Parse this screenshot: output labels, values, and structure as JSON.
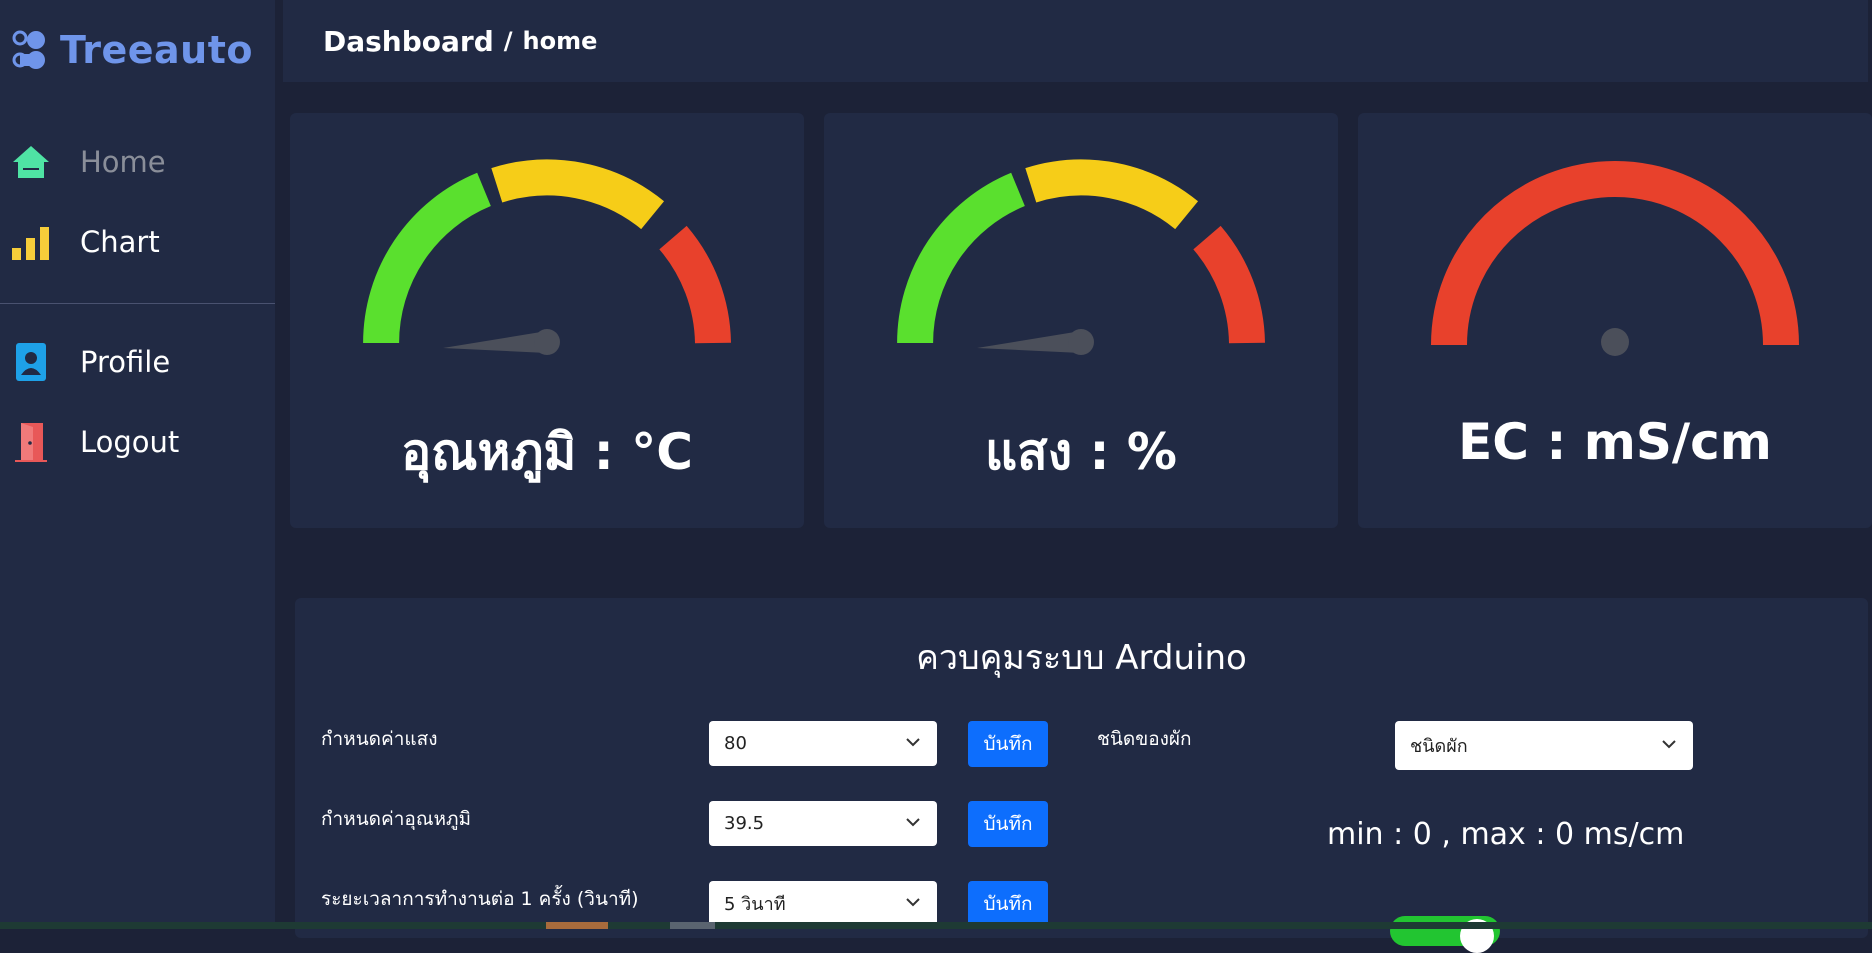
{
  "brand": {
    "name": "Treeauto"
  },
  "sidebar": {
    "items": [
      {
        "label": "Home",
        "icon": "home-icon",
        "active": true
      },
      {
        "label": "Chart",
        "icon": "bar-chart-icon",
        "active": false
      },
      {
        "label": "Profile",
        "icon": "profile-badge-icon",
        "active": false
      },
      {
        "label": "Logout",
        "icon": "door-icon",
        "active": false
      }
    ]
  },
  "header": {
    "title": "Dashboard",
    "separator": "/",
    "sub": "home"
  },
  "gauges": [
    {
      "title": "อุณหภูมิ : °C",
      "needle": "low"
    },
    {
      "title": "แสง : %",
      "needle": "low"
    },
    {
      "title": "EC : mS/cm",
      "needle": "none"
    }
  ],
  "panel": {
    "title": "ควบคุมระบบ Arduino",
    "light_label": "กำหนดค่าแสง",
    "light_value": "80",
    "temp_label": "กำหนดค่าอุณหภูมิ",
    "temp_value": "39.5",
    "duration_label": "ระยะเวลาการทำงานต่อ 1 ครั้ง (วินาที)",
    "duration_value": "5 วินาที",
    "save_label": "บันทึก",
    "veg_label": "ชนิดของผัก",
    "veg_value": "ชนิดผัก",
    "minmax_text": "min : 0 , max : 0 ms/cm",
    "toggle_on": true
  },
  "colors": {
    "green": "#5ae02e",
    "yellow": "#f6cd18",
    "red": "#e8412c",
    "accent": "#0d6efd",
    "brand": "#6f95ea"
  }
}
